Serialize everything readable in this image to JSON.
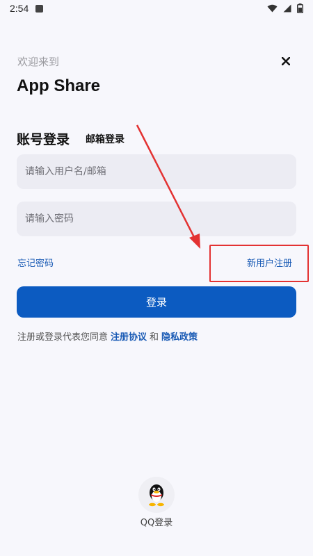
{
  "status_bar": {
    "time": "2:54"
  },
  "header": {
    "welcome": "欢迎来到",
    "app_name": "App Share"
  },
  "tabs": {
    "account": "账号登录",
    "email": "邮箱登录"
  },
  "form": {
    "username_placeholder": "请输入用户名/邮箱",
    "password_placeholder": "请输入密码",
    "forgot_password": "忘记密码",
    "register": "新用户注册",
    "login_button": "登录"
  },
  "agreement": {
    "prefix": "注册或登录代表您同意",
    "terms": "注册协议",
    "and": "和",
    "privacy": "隐私政策"
  },
  "social": {
    "qq_label": "QQ登录"
  },
  "colors": {
    "accent": "#0c5bc1",
    "link": "#1a5bb5",
    "annotation": "#e33232",
    "background": "#f7f7fc"
  }
}
